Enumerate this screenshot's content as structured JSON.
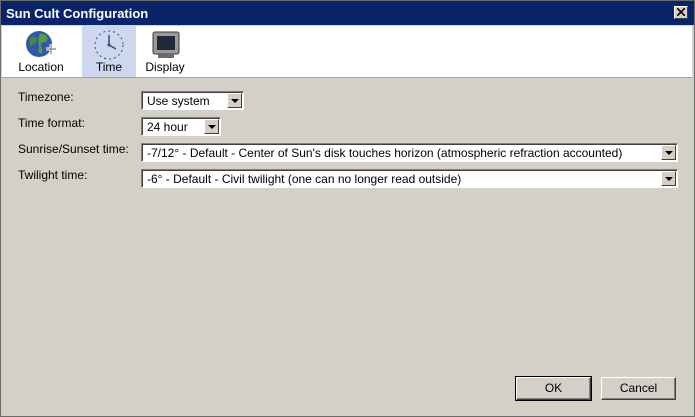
{
  "window": {
    "title": "Sun Cult Configuration"
  },
  "toolbar": {
    "items": [
      {
        "label": "Location",
        "icon": "globe-add-icon",
        "active": false
      },
      {
        "label": "Time",
        "icon": "clock-icon",
        "active": true
      },
      {
        "label": "Display",
        "icon": "monitor-icon",
        "active": false
      }
    ]
  },
  "form": {
    "timezone": {
      "label": "Timezone:",
      "value": "Use system"
    },
    "time_format": {
      "label": "Time format:",
      "value": "24 hour"
    },
    "sunrise_sunset": {
      "label": "Sunrise/Sunset time:",
      "value": "-7/12° - Default - Center of Sun's disk touches horizon (atmospheric refraction accounted)"
    },
    "twilight": {
      "label": "Twilight time:",
      "value": "-6° - Default - Civil twilight (one can no longer read outside)"
    }
  },
  "buttons": {
    "ok": "OK",
    "cancel": "Cancel"
  },
  "colors": {
    "titlebar": "#0a246a",
    "active_tab": "#cdd8ee",
    "face": "#d4d0c8"
  }
}
